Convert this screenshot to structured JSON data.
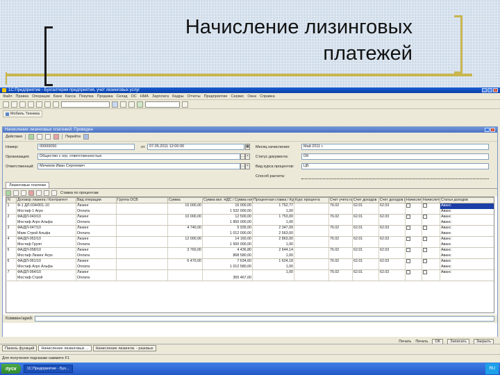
{
  "slide": {
    "title_line1": "Начисление лизинговых",
    "title_line2": "платежей"
  },
  "app": {
    "title": "1С:Предприятие - Бухгалтерия предприятия, учет лизинговых услуг",
    "menu": [
      "Файл",
      "Правка",
      "Операции",
      "Банк",
      "Касса",
      "Покупка",
      "Продажа",
      "Склад",
      "ОС",
      "НМА",
      "Зарплата",
      "Кадры",
      "Отчеты",
      "Предприятие",
      "Сервис",
      "Окна",
      "Справка"
    ],
    "quick_menu_label": "Мобиль Техника"
  },
  "document": {
    "title": "Начисление лизинговых платежей: Проведен",
    "actions_label": "Действия",
    "go_label": "Перейти",
    "fields": {
      "number_label": "Номер:",
      "number_value": "00000050",
      "date_label": "от",
      "date_value": "07.05.2011 12:00:00",
      "org_label": "Организация:",
      "org_value": "Общество с огр. ответственностью",
      "resp_label": "Ответственный:",
      "resp_value": "Мечиков Иван Сергеевич",
      "period_label": "Месяц начисления:",
      "period_value": "Май 2011 г.",
      "doc_status_label": "Статус документа:",
      "doc_status_value": "ОК",
      "rate_type_label": "Вид курса процентов:",
      "rate_type_value": "ЦБ",
      "calc_method_label": "Способ расчета:"
    },
    "tab_label": "Лизинговые платежи",
    "grid_tool_label": "Ставка по процентам",
    "columns": [
      "N",
      "Договор лизинга / Контрагент",
      "Вид операции",
      "Группа ОСВ",
      "Сумма",
      "Сумма вкл. НДС / Сумма начислений",
      "Процентная ставка / Курс процента",
      "Курс процента",
      "Счет учета платежей",
      "Счет доходов",
      "Счет доходов (НУ)",
      "Начислить НДС",
      "Начислить НДС (ИНУ)",
      "Статья доходов"
    ],
    "rows": [
      {
        "n": "1",
        "contract": "Ф-1 ДЛ-034/001-10",
        "counterparty": "Мостаф 1 Агро",
        "op": "Лизинг",
        "op2": "Оплата",
        "group": "",
        "sum": "15 000,00",
        "sum2": "16 000,00",
        "sum3": "1 532 000,00",
        "rate": "1 752,77",
        "rate2": "1,00",
        "course": "",
        "acc1": "76.02",
        "acc2": "62.01",
        "acc3": "62.03",
        "nds": "",
        "article": "Аванс",
        "article2": "Аванс"
      },
      {
        "n": "2",
        "contract": "ФА/ДЛ-043/10",
        "counterparty": "Мостаф Агро Альфа",
        "op": "Лизинг",
        "op2": "Оплата",
        "group": "",
        "sum": "10 000,00",
        "sum2": "12 500,00",
        "sum3": "1 850 000,00",
        "rate": "1 753,00",
        "rate2": "1,00",
        "course": "",
        "acc1": "76.02",
        "acc2": "62.01",
        "acc3": "62.03",
        "nds": "",
        "article": "Аванс",
        "article2": "Аванс"
      },
      {
        "n": "3",
        "contract": "ФА/ДЛ-047/10",
        "counterparty": "Маяк Строй Альфа",
        "op": "Лизинг",
        "op2": "Оплата",
        "group": "",
        "sum": "4 740,00",
        "sum2": "5 935,00",
        "sum3": "1 012 000,00",
        "rate": "2 347,09",
        "rate2": "2 563,00",
        "course": "",
        "acc1": "76.02",
        "acc2": "62.01",
        "acc3": "62.03",
        "nds": "",
        "article": "Аванс",
        "article2": "Аванс"
      },
      {
        "n": "4",
        "contract": "ФА/ДЛ-052/10",
        "counterparty": "Мостаф Групп",
        "op": "Лизинг",
        "op2": "Оплата",
        "group": "",
        "sum": "12 000,00",
        "sum2": "14 160,00",
        "sum3": "1 500 000,00",
        "rate": "2 863,00",
        "rate2": "1,00",
        "course": "",
        "acc1": "76.02",
        "acc2": "62.01",
        "acc3": "62.03",
        "nds": "",
        "article": "Аванс",
        "article2": "Аванс"
      },
      {
        "n": "5",
        "contract": "ФА/ДЛ-058/10",
        "counterparty": "Мостаф Лизинг Агро",
        "op": "Лизинг",
        "op2": "Оплата",
        "group": "",
        "sum": "3 760,00",
        "sum2": "4 436,80",
        "sum3": "868 580,00",
        "rate": "2 644,14",
        "rate2": "1,00",
        "course": "",
        "acc1": "76.02",
        "acc2": "62.01",
        "acc3": "62.03",
        "nds": "",
        "article": "Аванс",
        "article2": "Аванс"
      },
      {
        "n": "6",
        "contract": "ФА/ДЛ-061/10",
        "counterparty": "Мостаф Агро Альфа",
        "op": "Лизинг",
        "op2": "Оплата",
        "group": "",
        "sum": "6 470,00",
        "sum2": "7 634,60",
        "sum3": "1 012 580,00",
        "rate": "1 624,18",
        "rate2": "1,00",
        "course": "",
        "acc1": "76.02",
        "acc2": "62.01",
        "acc3": "62.03",
        "nds": "",
        "article": "Аванс",
        "article2": "Аванс"
      },
      {
        "n": "7",
        "contract": "ФА/ДЛ-064/10",
        "counterparty": "Мостаф Строй",
        "op": "Лизинг",
        "op2": "Оплата",
        "group": "",
        "sum": "",
        "sum2": "",
        "sum3": "365 467,00",
        "rate": "1,00",
        "rate2": "",
        "course": "",
        "acc1": "76.02",
        "acc2": "62.01",
        "acc3": "62.03",
        "nds": "",
        "article": "Аванс",
        "article2": ""
      }
    ],
    "comment_label": "Комментарий:",
    "footer": {
      "print_label": "Печать",
      "print_menu_label": "Печать",
      "ok_label": "OK",
      "save_label": "Записать",
      "close_label": "Закрыть"
    }
  },
  "window_tabs": [
    "Панель функций",
    "Начисление лизинговых ...",
    "Начисление лизингов. - разовых"
  ],
  "status_text": "Для получения подсказки нажмите F1",
  "taskbar": {
    "start_label": "пуск",
    "task_label": "1С:Предприятие - Бух...",
    "tray_time": "RU"
  }
}
